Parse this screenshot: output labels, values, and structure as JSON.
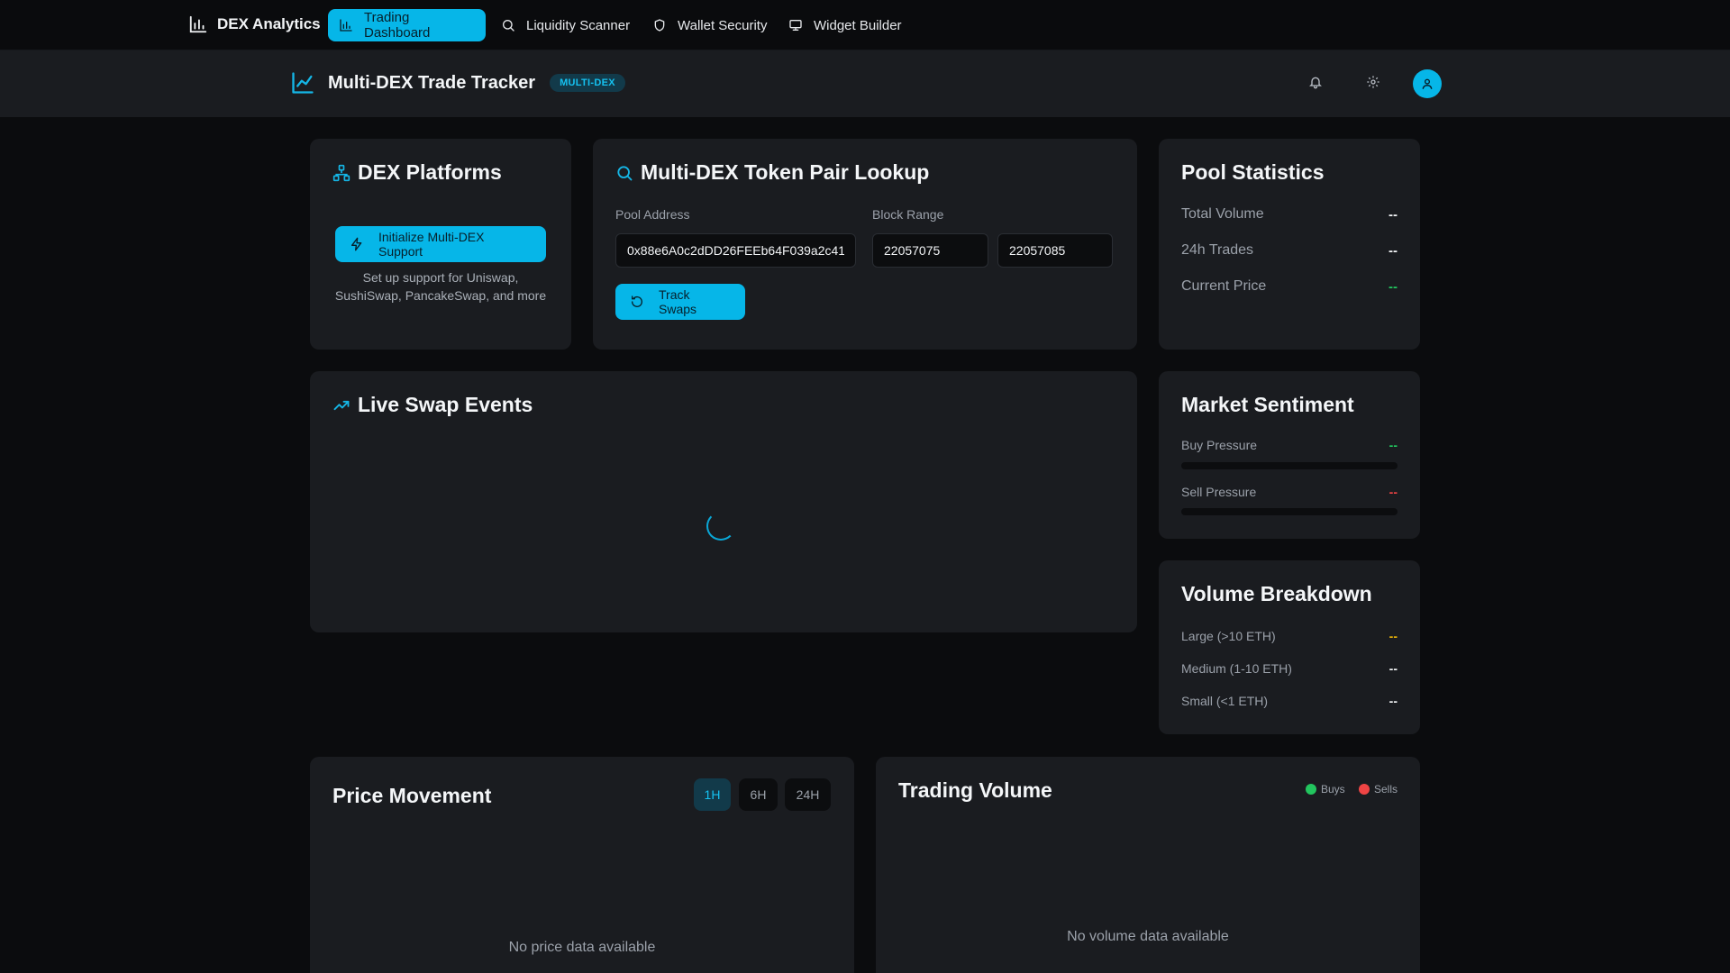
{
  "nav": {
    "brand": "DEX Analytics",
    "tabs": [
      {
        "label": "Trading Dashboard",
        "icon": "bar-chart-icon",
        "active": true
      },
      {
        "label": "Liquidity Scanner",
        "icon": "search-icon",
        "active": false
      },
      {
        "label": "Wallet Security",
        "icon": "shield-icon",
        "active": false
      },
      {
        "label": "Widget Builder",
        "icon": "monitor-icon",
        "active": false
      }
    ]
  },
  "header": {
    "title": "Multi-DEX Trade Tracker",
    "badge": "MULTI-DEX",
    "icons": [
      "bell-icon",
      "gear-icon",
      "user-icon"
    ]
  },
  "dex_platforms": {
    "title": "DEX Platforms",
    "button": "Initialize Multi-DEX Support",
    "help": "Set up support for Uniswap, SushiSwap, PancakeSwap, and more"
  },
  "lookup": {
    "title": "Multi-DEX Token Pair Lookup",
    "pool_label": "Pool Address",
    "pool_value": "0x88e6A0c2dDD26FEEb64F039a2c41",
    "block_label": "Block Range",
    "block_from": "22057075",
    "block_to": "22057085",
    "button": "Track Swaps"
  },
  "pool_stats": {
    "title": "Pool Statistics",
    "rows": [
      {
        "label": "Total Volume",
        "value": "--"
      },
      {
        "label": "24h Trades",
        "value": "--"
      },
      {
        "label": "Current Price",
        "value": "--"
      }
    ]
  },
  "live_swaps": {
    "title": "Live Swap Events"
  },
  "sentiment": {
    "title": "Market Sentiment",
    "buy_label": "Buy Pressure",
    "buy_value": "--",
    "sell_label": "Sell Pressure",
    "sell_value": "--"
  },
  "volume_breakdown": {
    "title": "Volume Breakdown",
    "rows": [
      {
        "label": "Large (>10 ETH)",
        "value": "--"
      },
      {
        "label": "Medium (1-10 ETH)",
        "value": "--"
      },
      {
        "label": "Small (<1 ETH)",
        "value": "--"
      }
    ]
  },
  "price_movement": {
    "title": "Price Movement",
    "timeframes": [
      "1H",
      "6H",
      "24H"
    ],
    "active_timeframe": "1H",
    "empty": "No price data available"
  },
  "trading_volume": {
    "title": "Trading Volume",
    "legend_buys": "Buys",
    "legend_sells": "Sells",
    "empty": "No volume data available"
  },
  "colors": {
    "accent": "#06b6e8",
    "buy": "#22c55e",
    "sell": "#ef4444",
    "warning": "#eab308"
  }
}
